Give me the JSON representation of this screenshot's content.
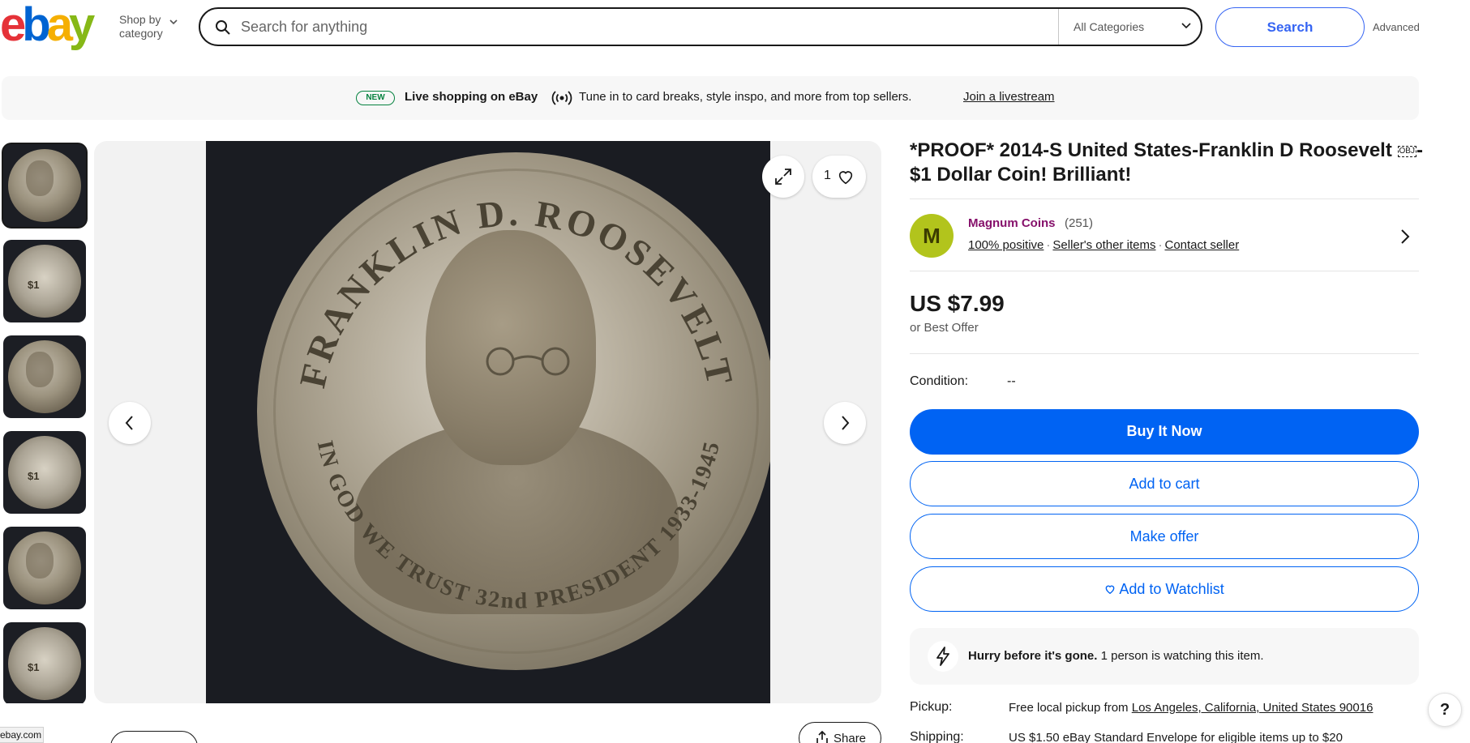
{
  "header": {
    "logo_letters": [
      "e",
      "b",
      "a",
      "y"
    ],
    "shop_by_line1": "Shop by",
    "shop_by_line2": "category",
    "search_placeholder": "Search for anything",
    "category_selected": "All Categories",
    "search_button": "Search",
    "advanced_link": "Advanced"
  },
  "banner": {
    "badge": "NEW",
    "title": "Live shopping on eBay",
    "text": "Tune in to card breaks, style inspo, and more from top sellers.",
    "link": "Join a livestream"
  },
  "gallery": {
    "watch_count": "1",
    "share_label": "Share",
    "thumbnail_count": 6
  },
  "coin": {
    "top_inscription": "FRANKLIN D. ROOSEVELT",
    "bottom_inscription": "IN GOD WE TRUST  32nd PRESIDENT  1933-1945"
  },
  "listing": {
    "title_part1": "*PROOF* 2014-S United States-Franklin D Roosevelt ",
    "title_obj": "OBJ",
    "title_part2": "- $1 Dollar Coin! Brilliant!",
    "seller": {
      "initial": "M",
      "name": "Magnum Coins",
      "feedback_count": "(251)",
      "positive": "100% positive",
      "other_items": "Seller's other items",
      "contact": "Contact seller"
    },
    "price": "US $7.99",
    "best_offer": "or Best Offer",
    "condition_label": "Condition:",
    "condition_value": "--",
    "buttons": {
      "buy_now": "Buy It Now",
      "add_to_cart": "Add to cart",
      "make_offer": "Make offer",
      "add_to_watchlist": "Add to Watchlist"
    },
    "hurry": {
      "bold": "Hurry before it's gone.",
      "rest": " 1 person is watching this item."
    },
    "pickup_label": "Pickup:",
    "pickup_text": "Free local pickup from ",
    "pickup_location": "Los Angeles, California, United States 90016",
    "shipping_label": "Shipping:",
    "shipping_text": "US $1.50 eBay Standard Envelope for eligible items up to $20"
  },
  "status_bar": "ebay.com",
  "help": "?",
  "colors": {
    "accent": "#0063f3",
    "seller_name": "#86116b",
    "avatar_bg": "#b2c41c",
    "new_badge": "#05823f"
  }
}
